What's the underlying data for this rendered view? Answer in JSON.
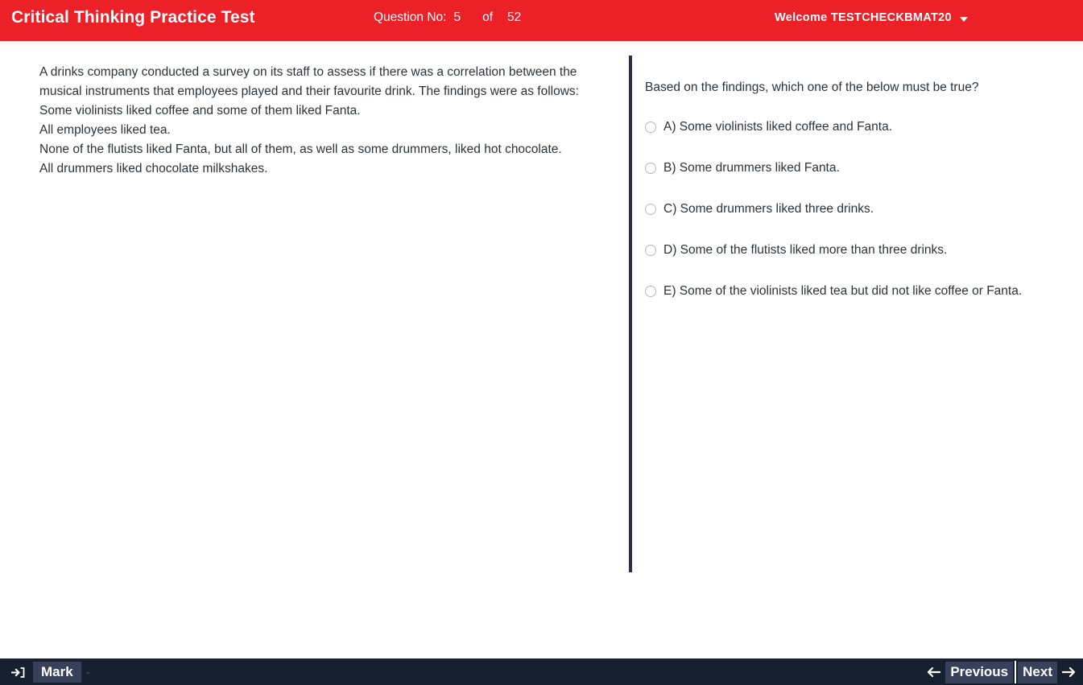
{
  "header": {
    "title": "Critical Thinking Practice Test",
    "question_label": "Question No:",
    "question_number": "5",
    "of_label": "of",
    "question_total": "52",
    "welcome_text": "Welcome TESTCHECKBMAT20",
    "caret_icon": "chevron-down-icon",
    "background_color": "#ec2027",
    "text_color": "#ffffff"
  },
  "question": {
    "stem": "A drinks company conducted a survey on its staff to assess if there was a correlation between the musical instruments that employees played and their favourite drink. The findings were as follows:\nSome violinists liked coffee and some of them liked Fanta.\nAll employees liked tea.\nNone of the flutists liked Fanta, but all of them, as well as some drummers, liked hot chocolate.\nAll drummers liked chocolate milkshakes."
  },
  "answers": {
    "prompt": "Based on the findings, which one of the below must be true?",
    "selected": null,
    "options": [
      {
        "id": "A",
        "label": "A) Some violinists liked coffee and Fanta."
      },
      {
        "id": "B",
        "label": "B) Some drummers liked Fanta."
      },
      {
        "id": "C",
        "label": "C) Some drummers liked three drinks."
      },
      {
        "id": "D",
        "label": "D) Some of the flutists liked more than three drinks."
      },
      {
        "id": "E",
        "label": "E) Some of the violinists liked tea but did not like coffee or Fanta."
      }
    ]
  },
  "footer": {
    "mark_icon": "sign-in-arrow-icon",
    "mark_label": "Mark",
    "mark_trailing": "-",
    "previous_label": "Previous",
    "next_label": "Next",
    "previous_icon": "arrow-left-icon",
    "next_icon": "arrow-right-icon",
    "background_color": "#17202f",
    "button_color": "#39415a"
  }
}
